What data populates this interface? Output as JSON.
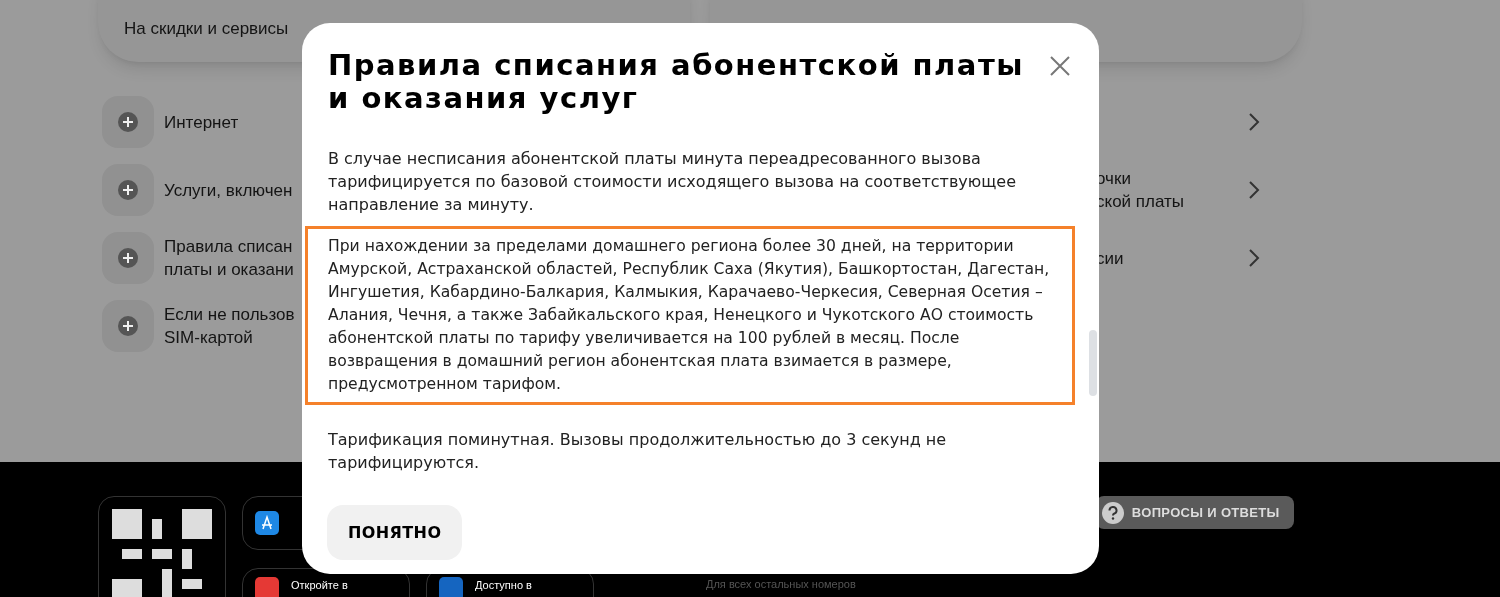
{
  "top_cards": [
    {
      "text": "На скидки и сервисы"
    }
  ],
  "left_list": [
    {
      "lines": [
        "Интернет"
      ]
    },
    {
      "lines": [
        "Услуги, включен"
      ]
    },
    {
      "lines": [
        "Правила списан",
        "платы и оказани"
      ]
    },
    {
      "lines": [
        "Если не пользов",
        "SIM-картой"
      ]
    }
  ],
  "right_list": [
    {
      "kind": "blank"
    },
    {
      "kind": "text",
      "lines": [
        "очки",
        "ской платы"
      ]
    },
    {
      "kind": "text",
      "lines": [
        "сии"
      ]
    }
  ],
  "footer": {
    "app_tiles": [
      {
        "caption": "Откройте в"
      },
      {
        "caption": "Доступно в"
      }
    ],
    "faq_button": "ВОПРОСЫ И ОТВЕТЫ",
    "note": "Для всех остальных номеров"
  },
  "modal": {
    "title": "Правила списания абонентской платы и оказания услуг",
    "paragraphs": [
      {
        "text": "В случае несписания абонентской платы минута переадресованного вызова тарифицируется по базовой стоимости исходящего вызова на соответствующее направление за минуту.",
        "highlighted": false
      },
      {
        "text": "При нахождении за пределами домашнего региона более 30 дней, на территории Амурской, Астраханской областей, Республик Саха (Якутия), Башкортостан, Дагестан, Ингушетия, Кабардино-Балкария, Калмыкия, Карачаево-Черкесия, Северная Осетия – Алания, Чечня, а также Забайкальского края, Ненецкого и Чукотского АО стоимость абонентской платы по тарифу увеличивается на 100 рублей в месяц. После возвращения в домашний регион абонентская плата взимается в размере, предусмотренном тарифом.",
        "highlighted": true
      },
      {
        "text": "Тарификация поминутная. Вызовы продолжительностью до 3 секунд не тарифицируются.",
        "highlighted": false
      }
    ],
    "button": "ПОНЯТНО"
  }
}
